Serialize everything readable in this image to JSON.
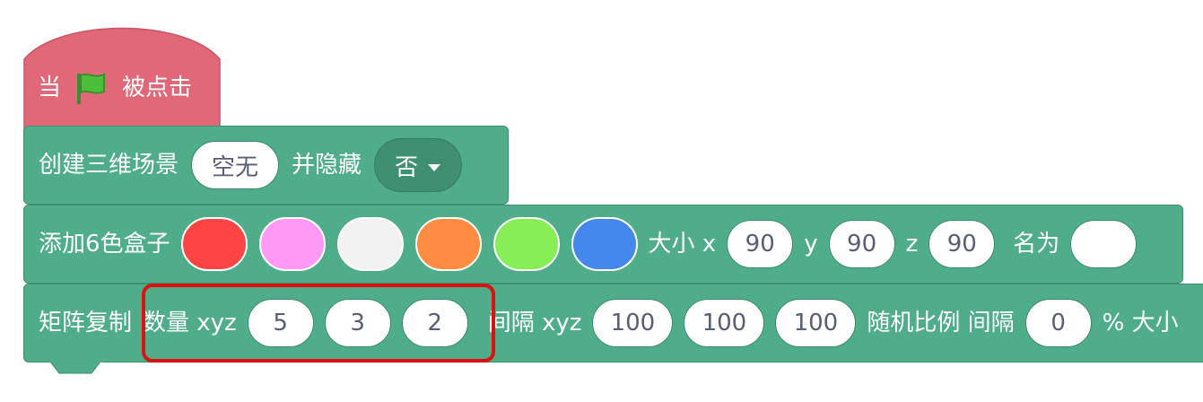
{
  "hat_block": {
    "label_before": "当",
    "label_after": "被点击",
    "icon": "green-flag-icon",
    "color": "#e06878"
  },
  "block_1": {
    "label": "创建三维场景",
    "scene_value": "空无",
    "hide_label": "并隐藏",
    "hide_value": "否",
    "color": "#4fad8a"
  },
  "block_2": {
    "label": "添加6色盒子",
    "colors": [
      "#ff4444",
      "#ff99f5",
      "#f2f2f2",
      "#ff8c40",
      "#88ee55",
      "#4488ee"
    ],
    "size_label": "大小 x",
    "x": "90",
    "y_label": "y",
    "y": "90",
    "z_label": "z",
    "z": "90",
    "name_label": "名为",
    "name_value": ""
  },
  "block_3": {
    "label": "矩阵复制",
    "count_label": "数量 xyz",
    "count_x": "5",
    "count_y": "3",
    "count_z": "2",
    "spacing_label": "间隔 xyz",
    "spacing_x": "100",
    "spacing_y": "100",
    "spacing_z": "100",
    "random_label": "随机比例 间隔",
    "random_value": "0",
    "tail_label": "% 大小",
    "highlight_color": "#dd1111"
  }
}
